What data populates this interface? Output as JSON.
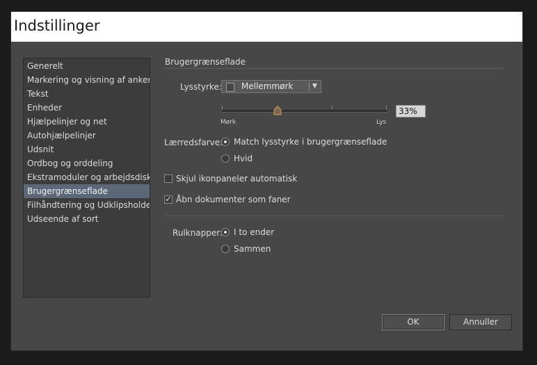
{
  "window": {
    "title": "Indstillinger"
  },
  "sidebar": {
    "items": [
      {
        "label": "Generelt"
      },
      {
        "label": "Markering og visning af anker"
      },
      {
        "label": "Tekst"
      },
      {
        "label": "Enheder"
      },
      {
        "label": "Hjælpelinjer og net"
      },
      {
        "label": "Autohjælpelinjer"
      },
      {
        "label": "Udsnit"
      },
      {
        "label": "Ordbog og orddeling"
      },
      {
        "label": "Ekstramoduler og arbejdsdiske"
      },
      {
        "label": "Brugergrænseflade",
        "selected": true
      },
      {
        "label": "Filhåndtering og Udklipsholder"
      },
      {
        "label": "Udseende af sort"
      }
    ]
  },
  "panel": {
    "section_title": "Brugergrænseflade",
    "brightness": {
      "label": "Lysstyrke:",
      "selected": "Mellemmørk",
      "slider_value": 0.33,
      "slider_text": "33%",
      "min_label": "Mørk",
      "max_label": "Lys"
    },
    "canvas_color": {
      "label": "Lærredsfarve:",
      "options": [
        {
          "label": "Match lysstyrke i brugergrænseflade",
          "checked": true
        },
        {
          "label": "Hvid",
          "checked": false
        }
      ]
    },
    "auto_collapse": {
      "label": "Skjul ikonpaneler automatisk",
      "checked": false
    },
    "open_as_tabs": {
      "label": "Åbn dokumenter som faner",
      "checked": true
    },
    "scroll_buttons": {
      "label": "Rulknapper:",
      "options": [
        {
          "label": "I to ender",
          "checked": true
        },
        {
          "label": "Sammen",
          "checked": false
        }
      ]
    }
  },
  "buttons": {
    "ok": "OK",
    "cancel": "Annuller"
  },
  "colors": {
    "selection": "#5c6878",
    "dialog_bg": "#474747",
    "titlebar_bg": "#ffffff"
  },
  "icons": {
    "dropdown": "chevron-down-icon",
    "checkmark": "checkmark-icon"
  }
}
